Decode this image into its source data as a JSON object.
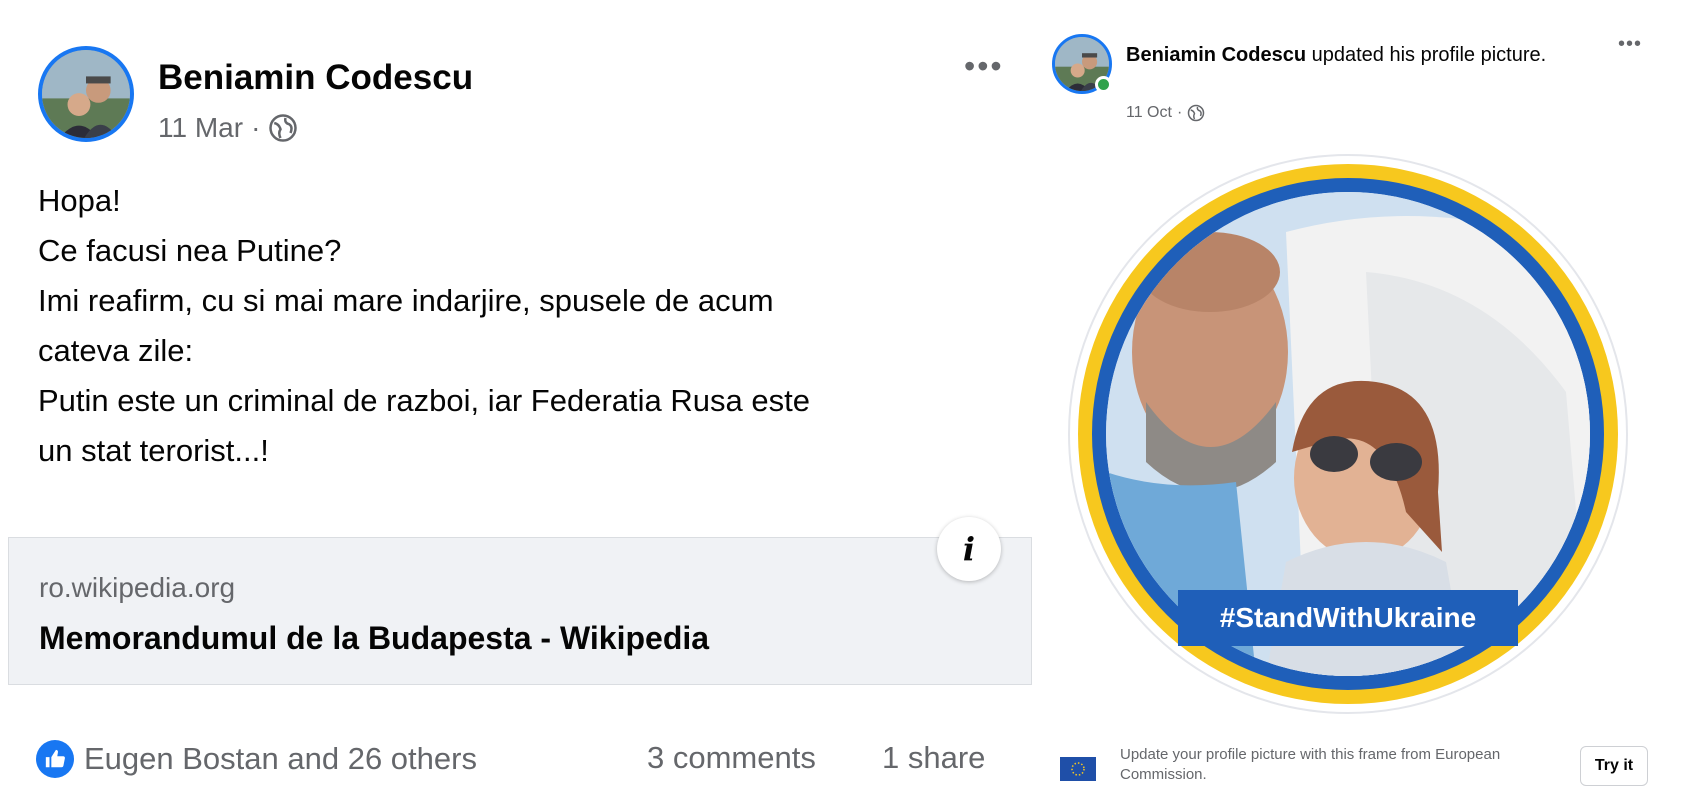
{
  "left_post": {
    "author": "Beniamin Codescu",
    "date": "11 Mar",
    "separator": "·",
    "audience_icon": "globe-icon",
    "more_icon": "more-dots-icon",
    "more_label": "•••",
    "text_lines": [
      "Hopa!",
      "Ce facusi nea Putine?",
      "Imi reafirm, cu si mai mare indarjire, spusele de acum",
      "cateva zile:",
      "Putin este un criminal de razboi, iar Federatia Rusa este",
      "un stat terorist...!"
    ],
    "link": {
      "domain": "ro.wikipedia.org",
      "title": "Memorandumul de la Budapesta - Wikipedia",
      "info_label": "i"
    },
    "reactions_text": "Eugen Bostan and 26 others",
    "comments_text": "3 comments",
    "shares_text": "1 share"
  },
  "right_post": {
    "author": "Beniamin Codescu",
    "action": "updated his profile picture.",
    "date": "11 Oct",
    "separator": "·",
    "more_label": "•••",
    "frame_label": "#StandWithUkraine",
    "footer_text": "Update your profile picture with this frame from European Commission.",
    "try_button": "Try it"
  },
  "colors": {
    "brand_blue": "#1877f2",
    "frame_yellow": "#f7c81e",
    "frame_blue": "#1f5fb9",
    "online_green": "#31a24c",
    "secondary_text": "#65676b"
  }
}
